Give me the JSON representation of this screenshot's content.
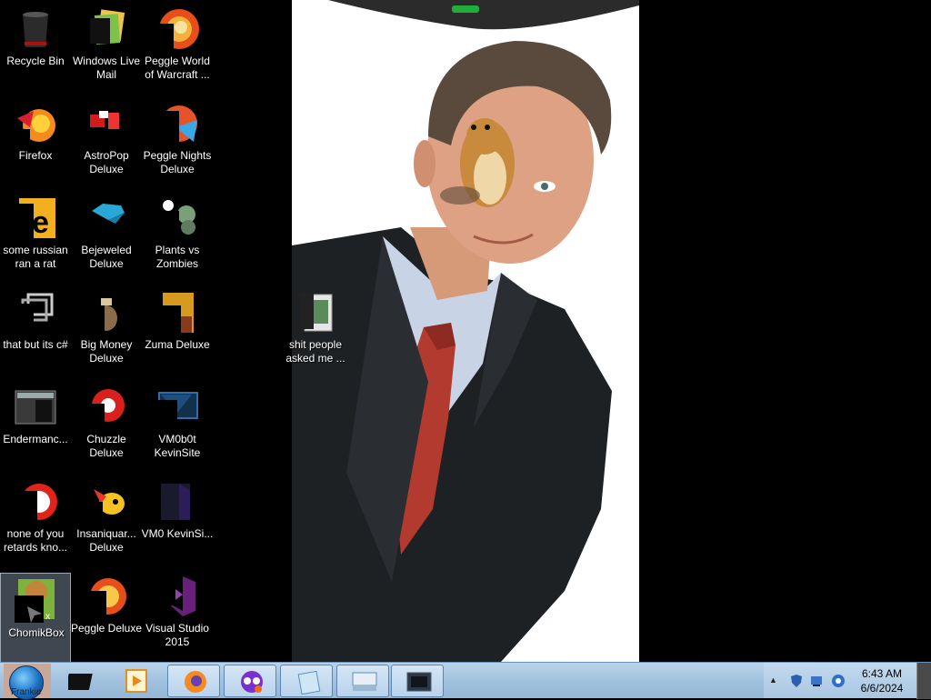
{
  "desktop": {
    "icons": [
      {
        "label": "Recycle Bin",
        "icon": "recycle-bin-icon"
      },
      {
        "label": "Windows Live Mail",
        "icon": "windows-live-mail-icon"
      },
      {
        "label": "Peggle World of Warcraft ...",
        "icon": "peggle-wow-icon"
      },
      {
        "label": "Firefox",
        "icon": "firefox-icon"
      },
      {
        "label": "AstroPop Deluxe",
        "icon": "astropop-icon"
      },
      {
        "label": "Peggle Nights Deluxe",
        "icon": "peggle-nights-icon"
      },
      {
        "label": "some russian ran a rat",
        "icon": "shortcut-e-icon"
      },
      {
        "label": "Bejeweled Deluxe",
        "icon": "bejeweled-icon"
      },
      {
        "label": "Plants vs Zombies",
        "icon": "plants-vs-zombies-icon"
      },
      {
        "label": "that but its c#",
        "icon": "shortcut-window-icon"
      },
      {
        "label": "Big Money Deluxe",
        "icon": "big-money-icon"
      },
      {
        "label": "Zuma Deluxe",
        "icon": "zuma-icon"
      },
      {
        "label": "Endermanc...",
        "icon": "endermanch-icon"
      },
      {
        "label": "Chuzzle Deluxe",
        "icon": "chuzzle-icon"
      },
      {
        "label": "VM0b0t KevinSite",
        "icon": "vm0b0t-icon"
      },
      {
        "label": "none of you retards kno...",
        "icon": "shortcut-red-icon"
      },
      {
        "label": "Insaniquar... Deluxe",
        "icon": "insaniquarium-icon"
      },
      {
        "label": "VM0 KevinSi...",
        "icon": "vm0-icon"
      },
      {
        "label": "ChomikBox",
        "icon": "chomikbox-icon"
      },
      {
        "label": "Peggle Deluxe",
        "icon": "peggle-deluxe-icon"
      },
      {
        "label": "Visual Studio 2015",
        "icon": "visual-studio-icon"
      },
      {
        "label": "shit people asked me ...",
        "icon": "folder-icon"
      }
    ]
  },
  "taskbar": {
    "start_label": "Frankie",
    "pinned": [
      {
        "name": "app-black-box-icon"
      },
      {
        "name": "media-player-icon"
      },
      {
        "name": "firefox-icon"
      },
      {
        "name": "bonzi-purple-icon"
      },
      {
        "name": "notepad-app-icon"
      },
      {
        "name": "keyboard-app-icon"
      },
      {
        "name": "display-app-icon"
      }
    ],
    "clock": {
      "time": "6:43 AM",
      "date": "6/6/2024"
    }
  },
  "colors": {
    "taskbar": "#a4c3e0",
    "desktop": "#000000",
    "selection": "#8ca0b4"
  }
}
